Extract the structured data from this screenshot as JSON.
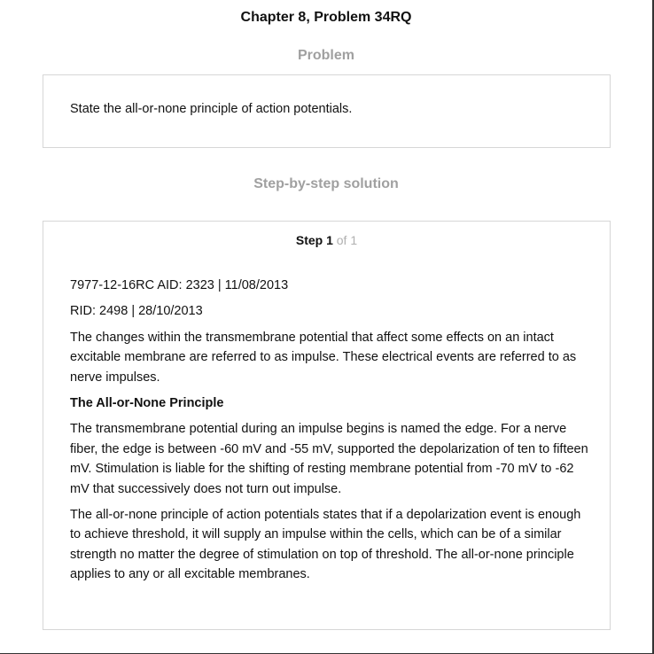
{
  "page": {
    "title": "Chapter 8, Problem 34RQ"
  },
  "problem": {
    "heading": "Problem",
    "text": "State the all-or-none principle of action potentials."
  },
  "solution": {
    "heading": "Step-by-step solution",
    "step_label": "Step 1",
    "step_of": "of 1",
    "paragraphs": [
      "7977-12-16RC AID: 2323 | 11/08/2013",
      "RID: 2498 | 28/10/2013",
      "The changes within the transmembrane potential that affect some effects on an intact excitable membrane are referred to as impulse. These electrical events are referred to as nerve impulses.",
      "The All-or-None Principle",
      "The transmembrane potential during an impulse begins is named the edge. For a nerve fiber, the edge is between -60 mV and -55 mV, supported the depolarization of ten to fifteen mV. Stimulation is liable for the shifting of resting membrane potential from -70 mV to -62 mV that successively does not turn out impulse.",
      "The all-or-none principle of action potentials states that if a depolarization event is enough to achieve threshold, it will supply an impulse within the cells, which can be of a similar strength no matter the degree of stimulation on top of threshold. The all-or-none principle applies to any or all excitable membranes."
    ]
  }
}
